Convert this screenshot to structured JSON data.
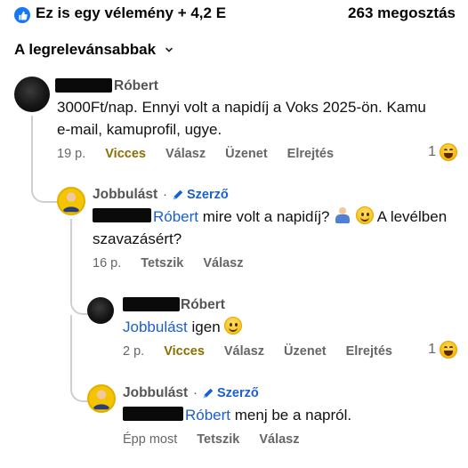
{
  "summary": {
    "reactions_label": "Ez is egy vélemény + 4,2 E",
    "shares_label": "263 megosztás",
    "like_icon": "thumbs-up-icon",
    "accent": "#1877f2"
  },
  "sort": {
    "label": "A legrelevánsabbak"
  },
  "comments": [
    {
      "name_suffix": "Róbert",
      "text": "3000Ft/nap. Ennyi volt a napidíj a Voks 2025-ön. Kamu e-mail, kamuprofil, ugye.",
      "time": "19 p.",
      "actions": [
        "Vicces",
        "Válasz",
        "Üzenet",
        "Elrejtés"
      ],
      "reaction_count": "1"
    },
    {
      "name": "Jobbulást",
      "separator": "·",
      "badge": "Szerző",
      "mention": "Róbert",
      "text_after_mention": " mire volt a napidíj? ",
      "text_tail": " A levélben szavazásért?",
      "time": "16 p.",
      "actions": [
        "Tetszik",
        "Válasz"
      ]
    },
    {
      "name_suffix": "Róbert",
      "mention": "Jobbulást",
      "text_after_mention": " igen ",
      "time": "2 p.",
      "actions": [
        "Vicces",
        "Válasz",
        "Üzenet",
        "Elrejtés"
      ],
      "reaction_count": "1"
    },
    {
      "name": "Jobbulást",
      "separator": "·",
      "badge": "Szerző",
      "mention": "Róbert",
      "text_after_mention": " menj be a napról.",
      "time": "Épp most",
      "actions": [
        "Tetszik",
        "Válasz"
      ]
    }
  ]
}
